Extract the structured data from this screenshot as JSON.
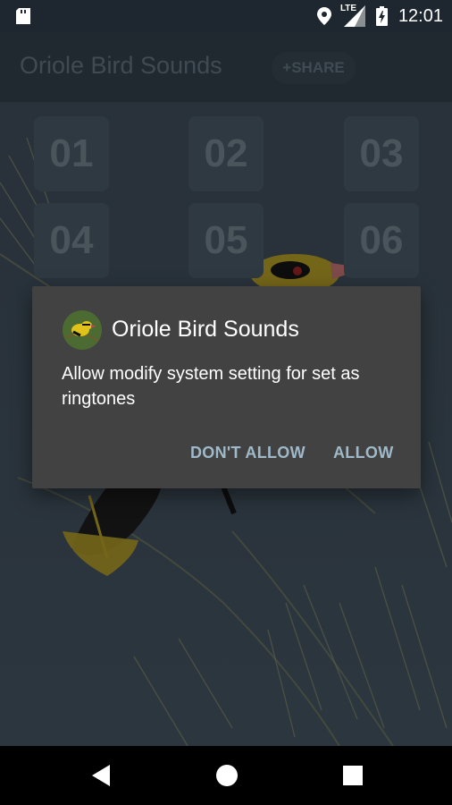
{
  "status_bar": {
    "network": "LTE",
    "time": "12:01"
  },
  "app_bar": {
    "title": "Oriole Bird Sounds",
    "share_label": "+SHARE"
  },
  "tiles": [
    "01",
    "02",
    "03",
    "04",
    "05",
    "06"
  ],
  "dialog": {
    "title": "Oriole Bird Sounds",
    "message": "Allow modify system setting for set as ringtones",
    "deny_label": "DON'T ALLOW",
    "allow_label": "ALLOW"
  },
  "nav_bar": {
    "icons": [
      "back-icon",
      "home-icon",
      "recents-icon"
    ]
  },
  "colors": {
    "accent": "#9fb9c9",
    "dialog_bg": "#424242"
  }
}
